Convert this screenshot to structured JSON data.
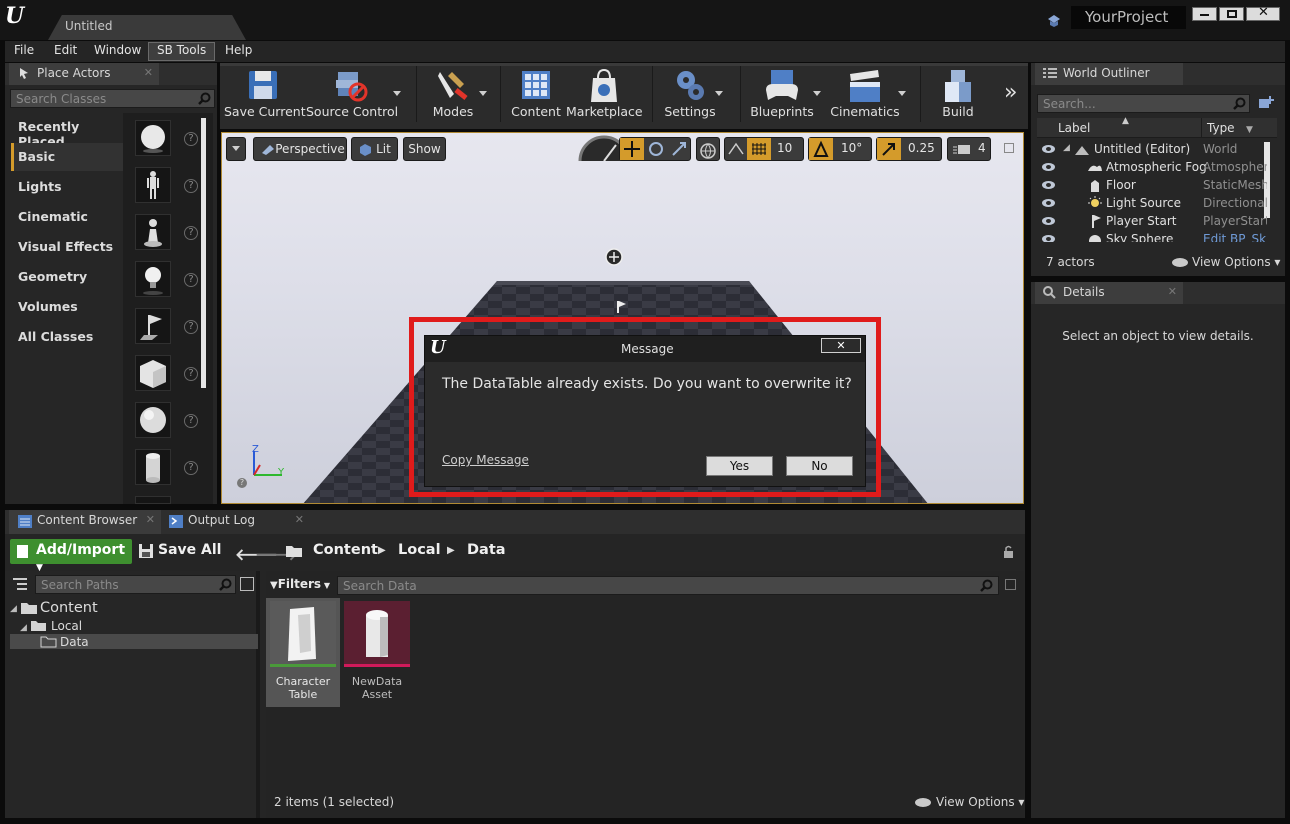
{
  "window": {
    "doc_tab": "Untitled",
    "project_name": "YourProject"
  },
  "menubar": [
    "File",
    "Edit",
    "Window",
    "SB Tools",
    "Help"
  ],
  "place_actors": {
    "tab_label": "Place Actors",
    "search_placeholder": "Search Classes",
    "categories": [
      "Recently Placed",
      "Basic",
      "Lights",
      "Cinematic",
      "Visual Effects",
      "Geometry",
      "Volumes",
      "All Classes"
    ],
    "selected_category": "Basic",
    "help_glyph": "?"
  },
  "toolbar": {
    "buttons": [
      {
        "label": "Save Current",
        "icon": "floppy-disk-icon"
      },
      {
        "label": "Source Control",
        "icon": "source-control-icon"
      },
      {
        "label": "Modes",
        "icon": "modes-tools-icon"
      },
      {
        "label": "Content",
        "icon": "content-grid-icon"
      },
      {
        "label": "Marketplace",
        "icon": "marketplace-bag-icon"
      },
      {
        "label": "Settings",
        "icon": "settings-gears-icon"
      },
      {
        "label": "Blueprints",
        "icon": "blueprints-controller-icon"
      },
      {
        "label": "Cinematics",
        "icon": "clapperboard-icon"
      },
      {
        "label": "Build",
        "icon": "build-cubes-icon"
      }
    ],
    "more_glyph": "»"
  },
  "viewport": {
    "perspective": "Perspective",
    "lit": "Lit",
    "show": "Show",
    "grid_snap": "10",
    "rotation_snap": "10°",
    "scale_snap": "0.25",
    "camera_speed": "4",
    "axis_z": "Z",
    "axis_y": "Y"
  },
  "dialog": {
    "title": "Message",
    "close_glyph": "✕",
    "message": "The DataTable already exists. Do you want to overwrite it?",
    "copy_link": "Copy Message",
    "yes": "Yes",
    "no": "No"
  },
  "world_outliner": {
    "tab_label": "World Outliner",
    "search_placeholder": "Search...",
    "col_label": "Label",
    "col_type": "Type",
    "rows": [
      {
        "label": "Untitled (Editor)",
        "type": "World"
      },
      {
        "label": "Atmospheric Fog",
        "type": "Atmospher"
      },
      {
        "label": "Floor",
        "type": "StaticMesh"
      },
      {
        "label": "Light Source",
        "type": "Directional"
      },
      {
        "label": "Player Start",
        "type": "PlayerStart"
      },
      {
        "label": "Sky Sphere",
        "type": "Edit BP_Sk"
      }
    ],
    "actor_count": "7 actors",
    "view_options": "View Options"
  },
  "details": {
    "tab_label": "Details",
    "empty_text": "Select an object to view details."
  },
  "content_browser": {
    "tab_label": "Content Browser",
    "output_tab": "Output Log",
    "add_import": "Add/Import",
    "save_all": "Save All",
    "path": [
      "Content",
      "Local",
      "Data"
    ],
    "search_paths": "Search Paths",
    "filters": "Filters",
    "search_data": "Search Data",
    "tree": [
      "Content",
      "Local",
      "Data"
    ],
    "assets": [
      {
        "line1": "Character",
        "line2": "Table",
        "selected": true
      },
      {
        "line1": "NewData",
        "line2": "Asset",
        "selected": false
      }
    ],
    "item_count": "2 items (1 selected)",
    "view_options": "View Options"
  }
}
